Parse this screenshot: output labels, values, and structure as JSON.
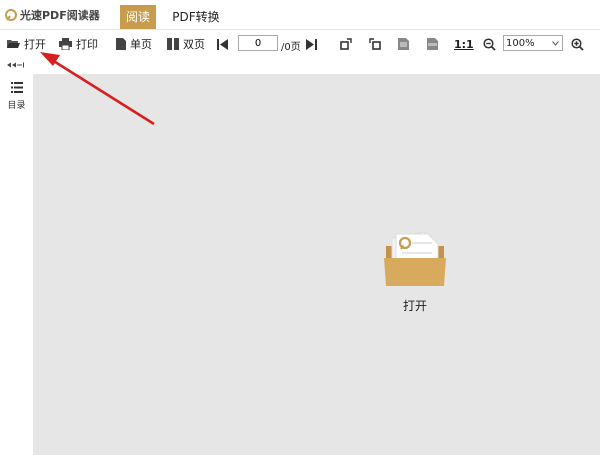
{
  "app": {
    "title": "光速PDF阅读器",
    "logo_icon": "app-logo-icon"
  },
  "tabs": [
    {
      "label": "阅读",
      "active": true
    },
    {
      "label": "PDF转换",
      "active": false
    }
  ],
  "toolbar": {
    "open_label": "打开",
    "print_label": "打印",
    "single_page_label": "单页",
    "double_page_label": "双页",
    "page_value": "0",
    "page_total": "/0页",
    "actual_size_label": "1:1",
    "zoom_value": "100%"
  },
  "sidebar": {
    "toc_label": "目录"
  },
  "viewer": {
    "open_label": "打开"
  },
  "colors": {
    "accent": "#c89c4d",
    "folder": "#d8aa5e",
    "viewer_bg": "#e6e6e6",
    "arrow": "#d62020"
  }
}
